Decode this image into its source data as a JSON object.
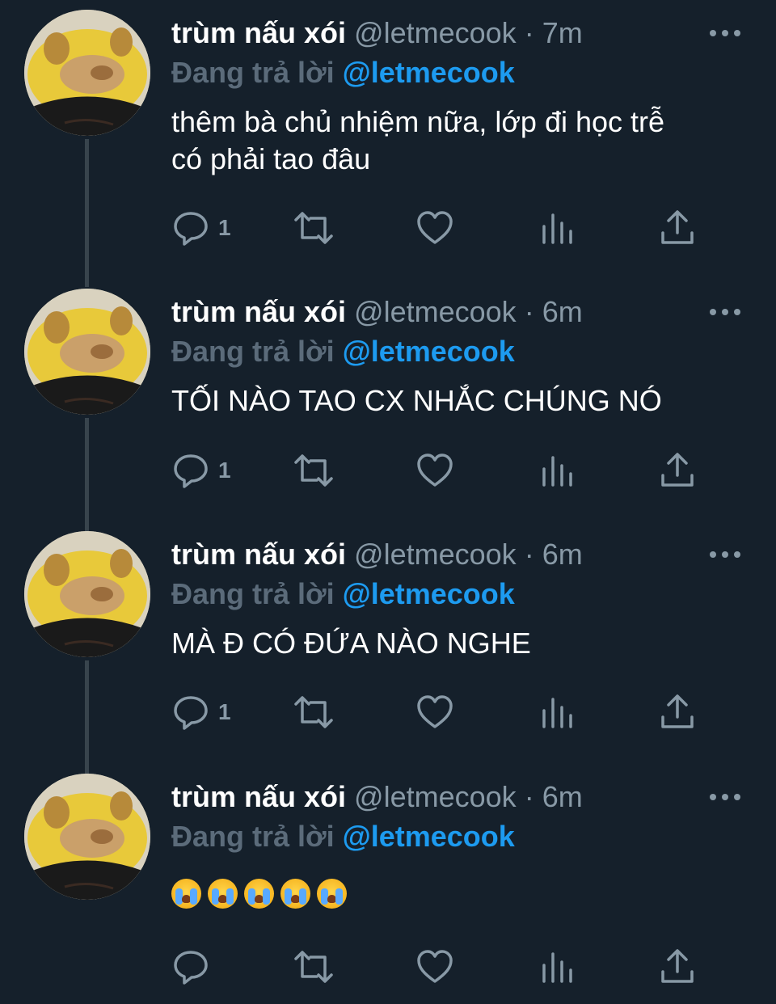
{
  "thread": [
    {
      "display_name": "trùm nấu xói",
      "handle": "@letmecook",
      "separator": "·",
      "time": "7m",
      "reply_prefix": "Đang trả lời",
      "reply_to": "@letmecook",
      "text": "thêm bà chủ nhiệm nữa, lớp đi học trễ\ncó phải tao đâu",
      "reply_count": "1"
    },
    {
      "display_name": "trùm nấu xói",
      "handle": "@letmecook",
      "separator": "·",
      "time": "6m",
      "reply_prefix": "Đang trả lời",
      "reply_to": "@letmecook",
      "text": "TỐI NÀO TAO CX NHẮC CHÚNG NÓ",
      "reply_count": "1"
    },
    {
      "display_name": "trùm nấu xói",
      "handle": "@letmecook",
      "separator": "·",
      "time": "6m",
      "reply_prefix": "Đang trả lời",
      "reply_to": "@letmecook",
      "text": "MÀ Đ CÓ ĐỨA NÀO NGHE",
      "reply_count": "1"
    },
    {
      "display_name": "trùm nấu xói",
      "handle": "@letmecook",
      "separator": "·",
      "time": "6m",
      "reply_prefix": "Đang trả lời",
      "reply_to": "@letmecook",
      "emoji": [
        "loudly-crying-face",
        "loudly-crying-face",
        "loudly-crying-face",
        "loudly-crying-face",
        "loudly-crying-face"
      ],
      "reply_count": ""
    }
  ],
  "colors": {
    "background": "#15202b",
    "text_primary": "#ffffff",
    "text_secondary": "#8899a6",
    "mention": "#1d9bf0",
    "thread_line": "#38444d"
  }
}
